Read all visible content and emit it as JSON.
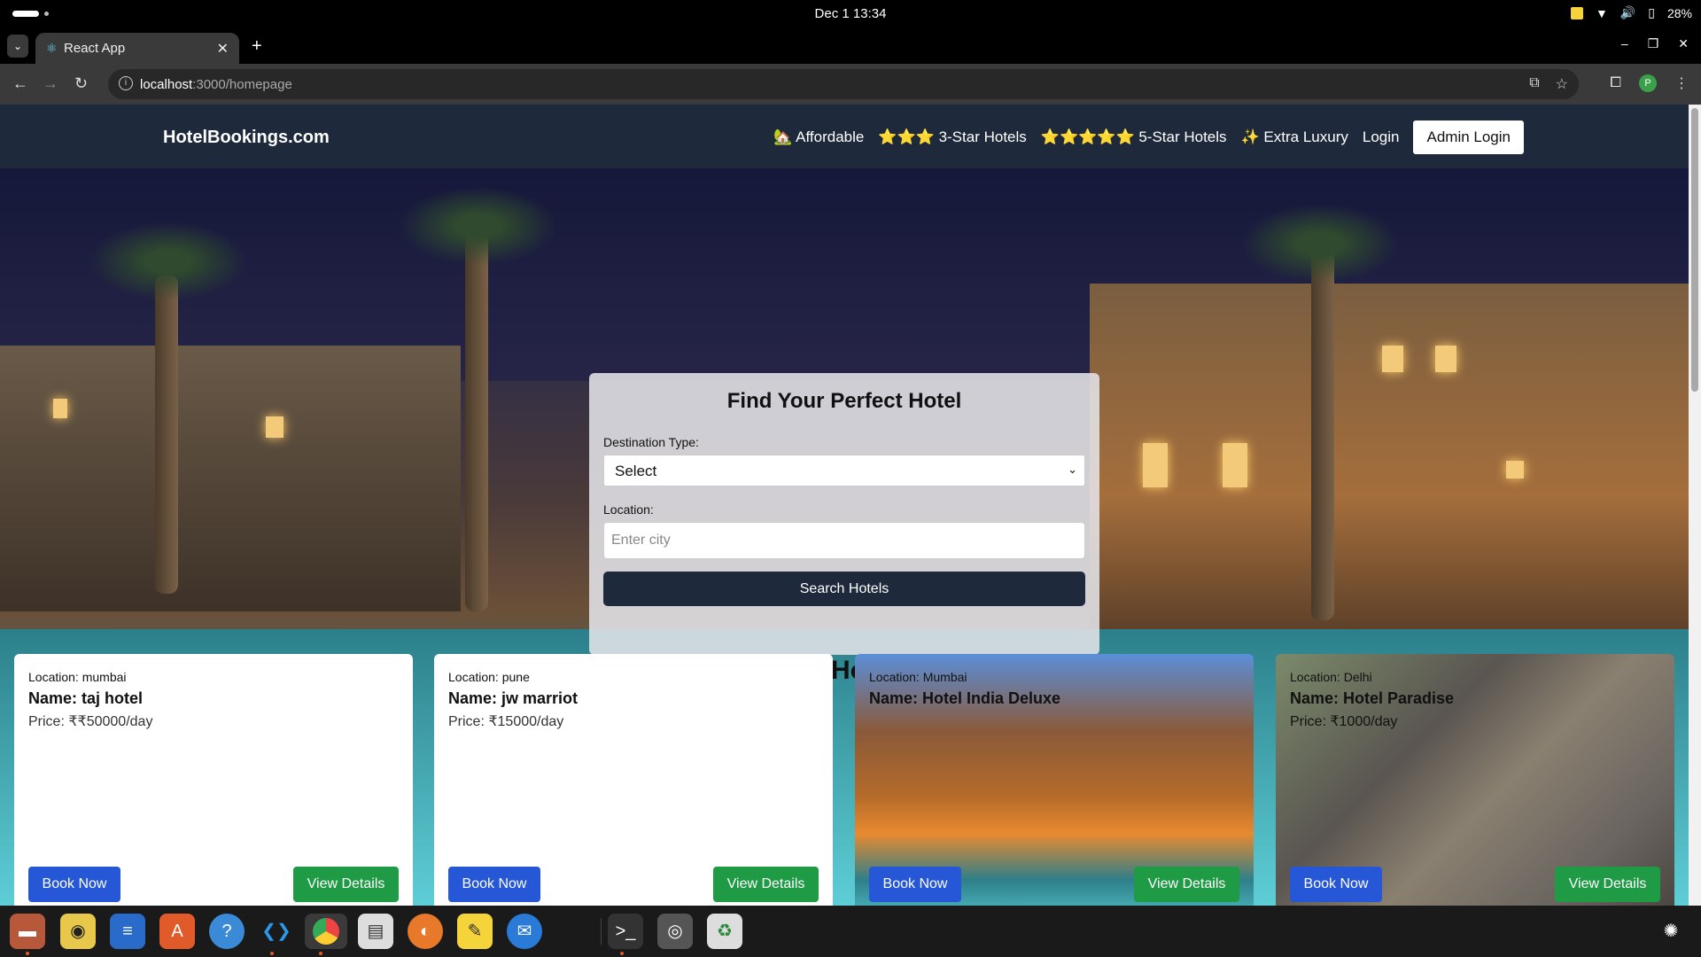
{
  "os": {
    "clock": "Dec 1  13:34",
    "battery": "28%"
  },
  "browser": {
    "tab_title": "React App",
    "url_host": "localhost",
    "url_path": ":3000/homepage"
  },
  "site": {
    "brand": "HotelBookings.com",
    "menu": {
      "affordable": "🏡 Affordable",
      "three_star": "⭐⭐⭐ 3-Star Hotels",
      "five_star": "⭐⭐⭐⭐⭐ 5-Star Hotels",
      "luxury": "✨ Extra Luxury",
      "login": "Login",
      "admin_login": "Admin Login"
    }
  },
  "search": {
    "title": "Find Your Perfect Hotel",
    "destination_label": "Destination Type:",
    "destination_value": "Select",
    "location_label": "Location:",
    "location_placeholder": "Enter city",
    "button": "Search Hotels"
  },
  "hotels_title": "Our Hotels",
  "hotels": [
    {
      "location": "Location: mumbai",
      "name": "Name: taj hotel",
      "price": "Price: ₹₹50000/day",
      "book": "Book Now",
      "details": "View Details"
    },
    {
      "location": "Location: pune",
      "name": "Name: jw marriot",
      "price": "Price: ₹15000/day",
      "book": "Book Now",
      "details": "View Details"
    },
    {
      "location": "Location: Mumbai",
      "name": "Name: Hotel India Deluxe",
      "price": "",
      "book": "Book Now",
      "details": "View Details"
    },
    {
      "location": "Location: Delhi",
      "name": "Name: Hotel Paradise",
      "price": "Price: ₹1000/day",
      "book": "Book Now",
      "details": "View Details"
    }
  ],
  "colors": {
    "nav_bg": "#1e293b",
    "book_btn": "#2557d6",
    "details_btn": "#1f9a45"
  }
}
